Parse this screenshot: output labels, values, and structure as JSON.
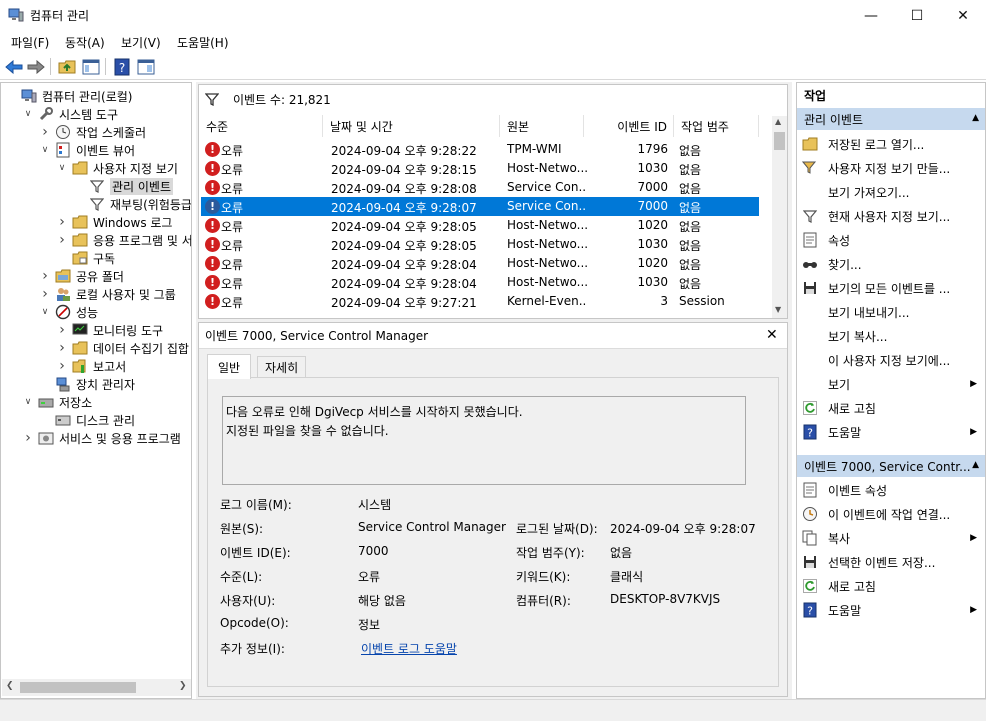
{
  "window": {
    "title": "컴퓨터 관리"
  },
  "menu": [
    "파일(F)",
    "동작(A)",
    "보기(V)",
    "도움말(H)"
  ],
  "tree": [
    {
      "label": "컴퓨터 관리(로컬)",
      "level": 0,
      "exp": "",
      "icon": "computer-icon"
    },
    {
      "label": "시스템 도구",
      "level": 1,
      "exp": "v",
      "icon": "tools-icon"
    },
    {
      "label": "작업 스케줄러",
      "level": 2,
      "exp": ">",
      "icon": "clock-icon"
    },
    {
      "label": "이벤트 뷰어",
      "level": 2,
      "exp": "v",
      "icon": "event-viewer-icon"
    },
    {
      "label": "사용자 지정 보기",
      "level": 3,
      "exp": "v",
      "icon": "folder-icon"
    },
    {
      "label": "관리 이벤트",
      "level": 4,
      "exp": "",
      "icon": "filter-icon",
      "selected": true
    },
    {
      "label": "재부팅(위험등급",
      "level": 4,
      "exp": "",
      "icon": "filter-icon"
    },
    {
      "label": "Windows 로그",
      "level": 3,
      "exp": ">",
      "icon": "folder-icon"
    },
    {
      "label": "응용 프로그램 및 서",
      "level": 3,
      "exp": ">",
      "icon": "folder-icon"
    },
    {
      "label": "구독",
      "level": 3,
      "exp": "",
      "icon": "subscription-icon"
    },
    {
      "label": "공유 폴더",
      "level": 2,
      "exp": ">",
      "icon": "shared-folder-icon"
    },
    {
      "label": "로컬 사용자 및 그룹",
      "level": 2,
      "exp": ">",
      "icon": "users-icon"
    },
    {
      "label": "성능",
      "level": 2,
      "exp": "v",
      "icon": "performance-icon"
    },
    {
      "label": "모니터링 도구",
      "level": 3,
      "exp": ">",
      "icon": "monitor-icon"
    },
    {
      "label": "데이터 수집기 집합",
      "level": 3,
      "exp": ">",
      "icon": "folder-icon"
    },
    {
      "label": "보고서",
      "level": 3,
      "exp": ">",
      "icon": "report-icon"
    },
    {
      "label": "장치 관리자",
      "level": 2,
      "exp": "",
      "icon": "device-manager-icon"
    },
    {
      "label": "저장소",
      "level": 1,
      "exp": "v",
      "icon": "storage-icon"
    },
    {
      "label": "디스크 관리",
      "level": 2,
      "exp": "",
      "icon": "disk-icon"
    },
    {
      "label": "서비스 및 응용 프로그램",
      "level": 1,
      "exp": ">",
      "icon": "services-icon"
    }
  ],
  "eventlist": {
    "count_label": "이벤트 수: 21,821",
    "columns": [
      "수준",
      "날짜 및 시간",
      "원본",
      "이벤트 ID",
      "작업 범주"
    ],
    "rows": [
      {
        "level": "오류",
        "datetime": "2024-09-04 오후 9:28:22",
        "source": "TPM-WMI",
        "id": "1796",
        "category": "없음",
        "selected": false
      },
      {
        "level": "오류",
        "datetime": "2024-09-04 오후 9:28:15",
        "source": "Host-Netwo...",
        "id": "1030",
        "category": "없음",
        "selected": false
      },
      {
        "level": "오류",
        "datetime": "2024-09-04 오후 9:28:08",
        "source": "Service Con...",
        "id": "7000",
        "category": "없음",
        "selected": false
      },
      {
        "level": "오류",
        "datetime": "2024-09-04 오후 9:28:07",
        "source": "Service Con...",
        "id": "7000",
        "category": "없음",
        "selected": true
      },
      {
        "level": "오류",
        "datetime": "2024-09-04 오후 9:28:05",
        "source": "Host-Netwo...",
        "id": "1020",
        "category": "없음",
        "selected": false
      },
      {
        "level": "오류",
        "datetime": "2024-09-04 오후 9:28:05",
        "source": "Host-Netwo...",
        "id": "1030",
        "category": "없음",
        "selected": false
      },
      {
        "level": "오류",
        "datetime": "2024-09-04 오후 9:28:04",
        "source": "Host-Netwo...",
        "id": "1020",
        "category": "없음",
        "selected": false
      },
      {
        "level": "오류",
        "datetime": "2024-09-04 오후 9:28:04",
        "source": "Host-Netwo...",
        "id": "1030",
        "category": "없음",
        "selected": false
      },
      {
        "level": "오류",
        "datetime": "2024-09-04 오후 9:27:21",
        "source": "Kernel-Even...",
        "id": "3",
        "category": "Session",
        "selected": false
      }
    ]
  },
  "detail": {
    "title": "이벤트 7000, Service Control Manager",
    "tabs": [
      "일반",
      "자세히"
    ],
    "message_line1": "다음 오류로 인해 DgiVecp 서비스를 시작하지 못했습니다.",
    "message_line2": "지정된 파일을 찾을 수 없습니다.",
    "log_name_label": "로그 이름(M):",
    "log_name": "시스템",
    "source_label": "원본(S):",
    "source": "Service Control Manager",
    "logged_label": "로그된 날짜(D):",
    "logged": "2024-09-04 오후 9:28:07",
    "event_id_label": "이벤트 ID(E):",
    "event_id": "7000",
    "task_category_label": "작업 범주(Y):",
    "task_category": "없음",
    "level_label": "수준(L):",
    "level": "오류",
    "keywords_label": "키워드(K):",
    "keywords": "클래식",
    "user_label": "사용자(U):",
    "user": "해당 없음",
    "computer_label": "컴퓨터(R):",
    "computer": "DESKTOP-8V7KVJS",
    "opcode_label": "Opcode(O):",
    "opcode": "정보",
    "more_info_label": "추가 정보(I):",
    "more_info_link": "이벤트 로그 도움말"
  },
  "actions": {
    "header": "작업",
    "section1": "관리 이벤트",
    "items1": [
      {
        "label": "저장된 로그 열기...",
        "icon": "open-log-icon",
        "arrow": false
      },
      {
        "label": "사용자 지정 보기 만들...",
        "icon": "filter-create-icon",
        "arrow": false
      },
      {
        "label": "보기 가져오기...",
        "icon": "",
        "arrow": false
      },
      {
        "label": "현재 사용자 지정 보기...",
        "icon": "filter-icon",
        "arrow": false
      },
      {
        "label": "속성",
        "icon": "properties-icon",
        "arrow": false
      },
      {
        "label": "찾기...",
        "icon": "find-icon",
        "arrow": false
      },
      {
        "label": "보기의 모든 이벤트를 ...",
        "icon": "save-icon",
        "arrow": false
      },
      {
        "label": "보기 내보내기...",
        "icon": "",
        "arrow": false
      },
      {
        "label": "보기 복사...",
        "icon": "",
        "arrow": false
      },
      {
        "label": "이 사용자 지정 보기에...",
        "icon": "",
        "arrow": false
      },
      {
        "label": "보기",
        "icon": "",
        "arrow": true
      },
      {
        "label": "새로 고침",
        "icon": "refresh-icon",
        "arrow": false
      },
      {
        "label": "도움말",
        "icon": "help-icon",
        "arrow": true
      }
    ],
    "section2": "이벤트 7000, Service Contr...",
    "items2": [
      {
        "label": "이벤트 속성",
        "icon": "event-properties-icon",
        "arrow": false
      },
      {
        "label": "이 이벤트에 작업 연결...",
        "icon": "attach-task-icon",
        "arrow": false
      },
      {
        "label": "복사",
        "icon": "copy-icon",
        "arrow": true
      },
      {
        "label": "선택한 이벤트 저장...",
        "icon": "save-icon",
        "arrow": false
      },
      {
        "label": "새로 고침",
        "icon": "refresh-icon",
        "arrow": false
      },
      {
        "label": "도움말",
        "icon": "help-icon",
        "arrow": true
      }
    ]
  }
}
